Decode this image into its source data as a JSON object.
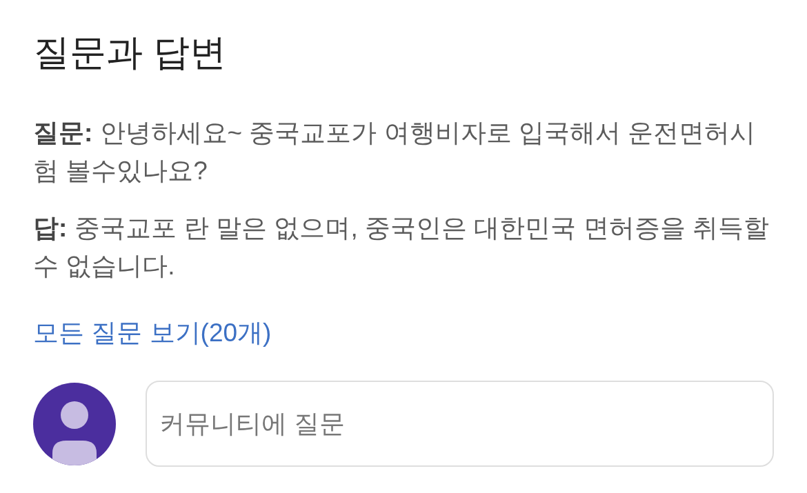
{
  "heading": {
    "text": "질문과 답변"
  },
  "question": {
    "text": "**질문:** 안녕하세요~ 중국교포가 여행비자로 입국해서 운전면허시험 볼수있나요?"
  },
  "answer": {
    "text": "**답:** 중국교포 란 말은 없으며, 중국인은 대한민국 면허증을 취득할 수 없습니다."
  },
  "all_questions_link": {
    "text": "모든 질문 보기(20개)"
  },
  "ask_field": {
    "placeholder": "커뮤니티에 질문"
  }
}
